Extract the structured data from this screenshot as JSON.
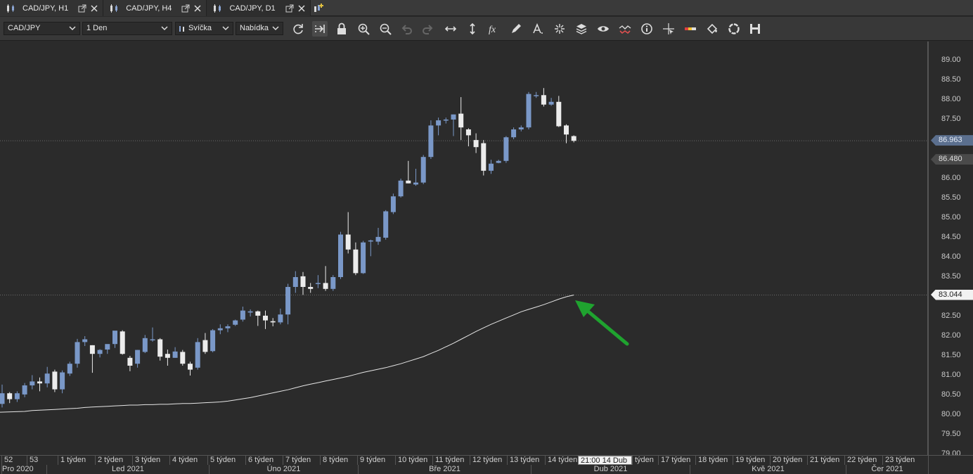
{
  "tabs": [
    {
      "label": "CAD/JPY, H1",
      "active": false
    },
    {
      "label": "CAD/JPY, H4",
      "active": false
    },
    {
      "label": "CAD/JPY, D1",
      "active": true
    }
  ],
  "toolbar": {
    "symbol": "CAD/JPY",
    "period": "1 Den",
    "chart_type": "Svíčka",
    "price_type": "Nabídka",
    "icons": [
      "refresh-icon",
      "shift-chart-icon",
      "lock-icon",
      "zoom-in-icon",
      "zoom-out-icon",
      "undo-icon",
      "redo-icon",
      "horizontal-line-icon",
      "vertical-line-icon",
      "indicator-fx-icon",
      "pencil-icon",
      "text-icon",
      "crosshair-icon",
      "layers-icon",
      "eye-icon",
      "signal-icon",
      "info-icon",
      "cursor-cross-icon",
      "color-bar-icon",
      "paint-bucket-icon",
      "circle-icon",
      "save-icon"
    ]
  },
  "price_axis": {
    "labels": [
      "89.00",
      "88.50",
      "88.00",
      "87.50",
      "87.00",
      "86.50",
      "86.00",
      "85.50",
      "85.00",
      "84.50",
      "84.00",
      "83.50",
      "83.00",
      "82.50",
      "82.00",
      "81.50",
      "81.00",
      "80.50",
      "80.00",
      "79.50",
      "79.00"
    ],
    "last_price": "86.963",
    "bid_price": "86.480",
    "ma_value": "83.044"
  },
  "time_axis": {
    "weeks": [
      "52",
      "53",
      "1 týden",
      "2 týden",
      "3 týden",
      "4 týden",
      "5 týden",
      "6 týden",
      "7 týden",
      "8 týden",
      "9 týden",
      "10 týden",
      "11 týden",
      "12 týden",
      "13 týden",
      "14 týden",
      "21:00 14 Dub",
      "týden",
      "17 týden",
      "18 týden",
      "19 týden",
      "20 týden",
      "21 týden",
      "22 týden",
      "23 týden"
    ],
    "months": [
      "Pro 2020",
      "Led 2021",
      "Úno 2021",
      "Bře 2021",
      "Dub 2021",
      "Kvě 2021",
      "Čer 2021"
    ]
  },
  "colors": {
    "bull": "#7a98c8",
    "bear": "#ececec",
    "background": "#2b2b2b",
    "arrow": "#1fa32f",
    "ma_line": "#e6e6e6"
  },
  "chart_data": {
    "type": "candlestick",
    "instrument": "CAD/JPY",
    "timeframe": "D1",
    "ylim": [
      79.0,
      89.25
    ],
    "grid": false,
    "candles": [
      {
        "o": 80.28,
        "h": 80.77,
        "l": 80.19,
        "c": 80.55
      },
      {
        "o": 80.55,
        "h": 80.58,
        "l": 80.3,
        "c": 80.4
      },
      {
        "o": 80.4,
        "h": 80.6,
        "l": 80.33,
        "c": 80.55
      },
      {
        "o": 80.52,
        "h": 80.81,
        "l": 80.45,
        "c": 80.75
      },
      {
        "o": 80.75,
        "h": 81.01,
        "l": 80.65,
        "c": 80.85
      },
      {
        "o": 80.85,
        "h": 80.95,
        "l": 80.6,
        "c": 80.8
      },
      {
        "o": 80.8,
        "h": 81.22,
        "l": 80.7,
        "c": 81.05
      },
      {
        "o": 81.1,
        "h": 81.15,
        "l": 80.58,
        "c": 80.65
      },
      {
        "o": 80.65,
        "h": 81.13,
        "l": 80.55,
        "c": 81.08
      },
      {
        "o": 81.05,
        "h": 81.35,
        "l": 80.99,
        "c": 81.3
      },
      {
        "o": 81.3,
        "h": 81.93,
        "l": 81.2,
        "c": 81.85
      },
      {
        "o": 81.85,
        "h": 82.0,
        "l": 81.75,
        "c": 81.92
      },
      {
        "o": 81.77,
        "h": 81.77,
        "l": 81.07,
        "c": 81.55
      },
      {
        "o": 81.55,
        "h": 81.67,
        "l": 81.46,
        "c": 81.65
      },
      {
        "o": 81.66,
        "h": 81.75,
        "l": 81.55,
        "c": 81.8
      },
      {
        "o": 81.8,
        "h": 82.12,
        "l": 81.7,
        "c": 82.14
      },
      {
        "o": 82.12,
        "h": 82.15,
        "l": 81.53,
        "c": 81.55
      },
      {
        "o": 81.45,
        "h": 81.5,
        "l": 81.11,
        "c": 81.25
      },
      {
        "o": 81.3,
        "h": 81.65,
        "l": 81.2,
        "c": 81.65
      },
      {
        "o": 81.6,
        "h": 82.03,
        "l": 81.57,
        "c": 81.95
      },
      {
        "o": 81.9,
        "h": 82.22,
        "l": 81.86,
        "c": 81.92
      },
      {
        "o": 81.92,
        "h": 81.95,
        "l": 81.38,
        "c": 81.48
      },
      {
        "o": 81.55,
        "h": 81.66,
        "l": 81.25,
        "c": 81.45
      },
      {
        "o": 81.45,
        "h": 81.72,
        "l": 81.45,
        "c": 81.61
      },
      {
        "o": 81.6,
        "h": 81.65,
        "l": 81.25,
        "c": 81.3
      },
      {
        "o": 81.3,
        "h": 81.35,
        "l": 81.0,
        "c": 81.15
      },
      {
        "o": 81.2,
        "h": 81.95,
        "l": 81.15,
        "c": 81.85
      },
      {
        "o": 81.9,
        "h": 82.08,
        "l": 81.55,
        "c": 81.6
      },
      {
        "o": 81.62,
        "h": 82.18,
        "l": 81.59,
        "c": 82.15
      },
      {
        "o": 82.15,
        "h": 82.3,
        "l": 82.05,
        "c": 82.2
      },
      {
        "o": 82.2,
        "h": 82.3,
        "l": 82.1,
        "c": 82.25
      },
      {
        "o": 82.29,
        "h": 82.42,
        "l": 82.26,
        "c": 82.4
      },
      {
        "o": 82.42,
        "h": 82.75,
        "l": 82.37,
        "c": 82.65
      },
      {
        "o": 82.6,
        "h": 82.68,
        "l": 82.5,
        "c": 82.63
      },
      {
        "o": 82.63,
        "h": 82.65,
        "l": 82.26,
        "c": 82.52
      },
      {
        "o": 82.52,
        "h": 82.65,
        "l": 82.18,
        "c": 82.4
      },
      {
        "o": 82.38,
        "h": 82.46,
        "l": 82.25,
        "c": 82.35
      },
      {
        "o": 82.35,
        "h": 82.7,
        "l": 82.3,
        "c": 82.55
      },
      {
        "o": 82.55,
        "h": 83.33,
        "l": 82.3,
        "c": 83.25
      },
      {
        "o": 83.25,
        "h": 83.65,
        "l": 83.1,
        "c": 83.5
      },
      {
        "o": 83.52,
        "h": 83.63,
        "l": 83.05,
        "c": 83.25
      },
      {
        "o": 83.25,
        "h": 83.35,
        "l": 83.1,
        "c": 83.2
      },
      {
        "o": 83.35,
        "h": 83.55,
        "l": 83.22,
        "c": 83.35
      },
      {
        "o": 83.35,
        "h": 83.78,
        "l": 83.15,
        "c": 83.2
      },
      {
        "o": 83.2,
        "h": 83.55,
        "l": 83.15,
        "c": 83.5
      },
      {
        "o": 83.5,
        "h": 84.65,
        "l": 83.45,
        "c": 84.58
      },
      {
        "o": 84.58,
        "h": 85.15,
        "l": 84.1,
        "c": 84.2
      },
      {
        "o": 84.2,
        "h": 84.38,
        "l": 83.55,
        "c": 83.6
      },
      {
        "o": 83.6,
        "h": 84.42,
        "l": 83.58,
        "c": 84.38
      },
      {
        "o": 84.42,
        "h": 84.45,
        "l": 84.03,
        "c": 84.43
      },
      {
        "o": 84.4,
        "h": 84.75,
        "l": 84.32,
        "c": 84.52
      },
      {
        "o": 84.5,
        "h": 85.2,
        "l": 84.45,
        "c": 85.17
      },
      {
        "o": 85.15,
        "h": 85.62,
        "l": 85.1,
        "c": 85.55
      },
      {
        "o": 85.55,
        "h": 86.0,
        "l": 85.52,
        "c": 85.95
      },
      {
        "o": 85.95,
        "h": 86.45,
        "l": 85.88,
        "c": 85.88
      },
      {
        "o": 85.85,
        "h": 86.25,
        "l": 85.82,
        "c": 85.9
      },
      {
        "o": 85.9,
        "h": 86.6,
        "l": 85.86,
        "c": 86.55
      },
      {
        "o": 86.55,
        "h": 87.48,
        "l": 86.5,
        "c": 87.35
      },
      {
        "o": 87.35,
        "h": 87.55,
        "l": 87.1,
        "c": 87.48
      },
      {
        "o": 87.48,
        "h": 87.55,
        "l": 87.4,
        "c": 87.5
      },
      {
        "o": 87.5,
        "h": 87.63,
        "l": 87.08,
        "c": 87.63
      },
      {
        "o": 87.65,
        "h": 88.07,
        "l": 86.98,
        "c": 87.3
      },
      {
        "o": 87.25,
        "h": 87.28,
        "l": 86.82,
        "c": 87.1
      },
      {
        "o": 86.98,
        "h": 87.15,
        "l": 86.65,
        "c": 86.8
      },
      {
        "o": 86.9,
        "h": 86.98,
        "l": 86.08,
        "c": 86.2
      },
      {
        "o": 86.2,
        "h": 86.48,
        "l": 86.12,
        "c": 86.38
      },
      {
        "o": 86.4,
        "h": 86.48,
        "l": 86.39,
        "c": 86.45
      },
      {
        "o": 86.45,
        "h": 87.08,
        "l": 86.4,
        "c": 87.05
      },
      {
        "o": 87.05,
        "h": 87.3,
        "l": 87.0,
        "c": 87.25
      },
      {
        "o": 87.25,
        "h": 87.35,
        "l": 87.2,
        "c": 87.3
      },
      {
        "o": 87.3,
        "h": 88.2,
        "l": 87.25,
        "c": 88.15
      },
      {
        "o": 88.1,
        "h": 88.2,
        "l": 88.05,
        "c": 88.12
      },
      {
        "o": 88.12,
        "h": 88.3,
        "l": 87.83,
        "c": 87.88
      },
      {
        "o": 87.88,
        "h": 88.05,
        "l": 87.85,
        "c": 87.95
      },
      {
        "o": 87.95,
        "h": 88.1,
        "l": 87.31,
        "c": 87.33
      },
      {
        "o": 87.35,
        "h": 87.38,
        "l": 86.9,
        "c": 87.12
      },
      {
        "o": 87.08,
        "h": 87.1,
        "l": 86.92,
        "c": 86.96
      }
    ],
    "series": [
      {
        "type": "line",
        "values": [
          80.07,
          80.09,
          80.11,
          80.12,
          80.13,
          80.14,
          80.15,
          80.16,
          80.17,
          80.19,
          80.2,
          80.21,
          80.22,
          80.23,
          80.24,
          80.25,
          80.25,
          80.26,
          80.26,
          80.27,
          80.27,
          80.28,
          80.29,
          80.29,
          80.3,
          80.31,
          80.32,
          80.33,
          80.35,
          80.38,
          80.41,
          80.44,
          80.48,
          80.52,
          80.56,
          80.6,
          80.64,
          80.69,
          80.74,
          80.78,
          80.82,
          80.86,
          80.9,
          80.94,
          80.98,
          81.03,
          81.08,
          81.12,
          81.16,
          81.2,
          81.25,
          81.3,
          81.36,
          81.42,
          81.48,
          81.56,
          81.64,
          81.73,
          81.82,
          81.92,
          82.02,
          82.12,
          82.21,
          82.3,
          82.38,
          82.46,
          82.54,
          82.62,
          82.68,
          82.74,
          82.8,
          82.87,
          82.94,
          83.0,
          83.044
        ]
      }
    ]
  }
}
